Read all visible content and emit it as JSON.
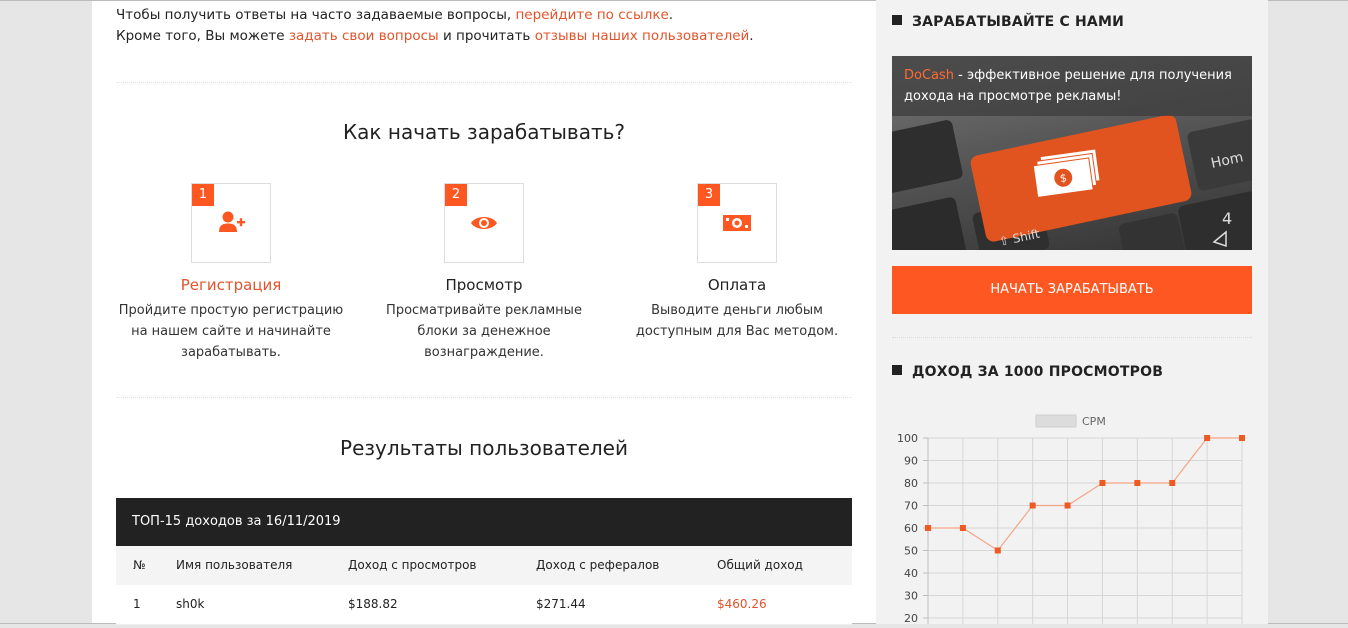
{
  "intro": {
    "line1_text": "Чтобы получить ответы на часто задаваемые вопросы, ",
    "line1_link": "перейдите по ссылке",
    "line1_end": ".",
    "line2_text": "Кроме того, Вы можете ",
    "line2_link1": "задать свои вопросы",
    "line2_mid": " и прочитать ",
    "line2_link2": "отзывы наших пользователей",
    "line2_end": "."
  },
  "how_to": {
    "title": "Как начать зарабатывать?",
    "steps": [
      {
        "num": "1",
        "icon": "user-add-icon",
        "title": "Регистрация",
        "desc": "Пройдите простую регистрацию на нашем сайте и начинайте зарабатывать."
      },
      {
        "num": "2",
        "icon": "eye-icon",
        "title": "Просмотр",
        "desc": "Просматривайте рекламные блоки за денежное вознаграждение."
      },
      {
        "num": "3",
        "icon": "money-icon",
        "title": "Оплата",
        "desc": "Выводите деньги любым доступным для Вас методом."
      }
    ]
  },
  "results": {
    "title": "Результаты пользователей",
    "table_title": "ТОП-15 доходов за 16/11/2019",
    "columns": [
      "№",
      "Имя пользователя",
      "Доход с просмотров",
      "Доход с рефералов",
      "Общий доход"
    ],
    "rows": [
      [
        "1",
        "sh0k",
        "$188.82",
        "$271.44",
        "$460.26"
      ]
    ]
  },
  "sidebar": {
    "earn_title": "ЗАРАБАТЫВАЙТЕ С НАМИ",
    "promo_brand": "DoCash",
    "promo_text": " - эффективное решение для получения дохода на просмотре рекламы!",
    "start_button": "НАЧАТЬ ЗАРАБАТЫВАТЬ",
    "income_title": "ДОХОД ЗА 1000 ПРОСМОТРОВ"
  },
  "colors": {
    "accent": "#ff5722",
    "link": "#e2542b",
    "dark": "#222222"
  },
  "chart_data": {
    "type": "line",
    "series": [
      {
        "name": "CPM",
        "values": [
          60,
          60,
          50,
          70,
          70,
          80,
          80,
          80,
          100,
          100
        ]
      }
    ],
    "x": [
      1,
      2,
      3,
      4,
      5,
      6,
      7,
      8,
      9,
      10
    ],
    "y_ticks": [
      "100",
      "90",
      "80",
      "70",
      "60",
      "50",
      "40",
      "30",
      "20"
    ],
    "ylim": [
      0,
      100
    ],
    "grid": true,
    "legend": "top-center",
    "line_color": "#f4a585",
    "point_color": "#ee5a24"
  }
}
